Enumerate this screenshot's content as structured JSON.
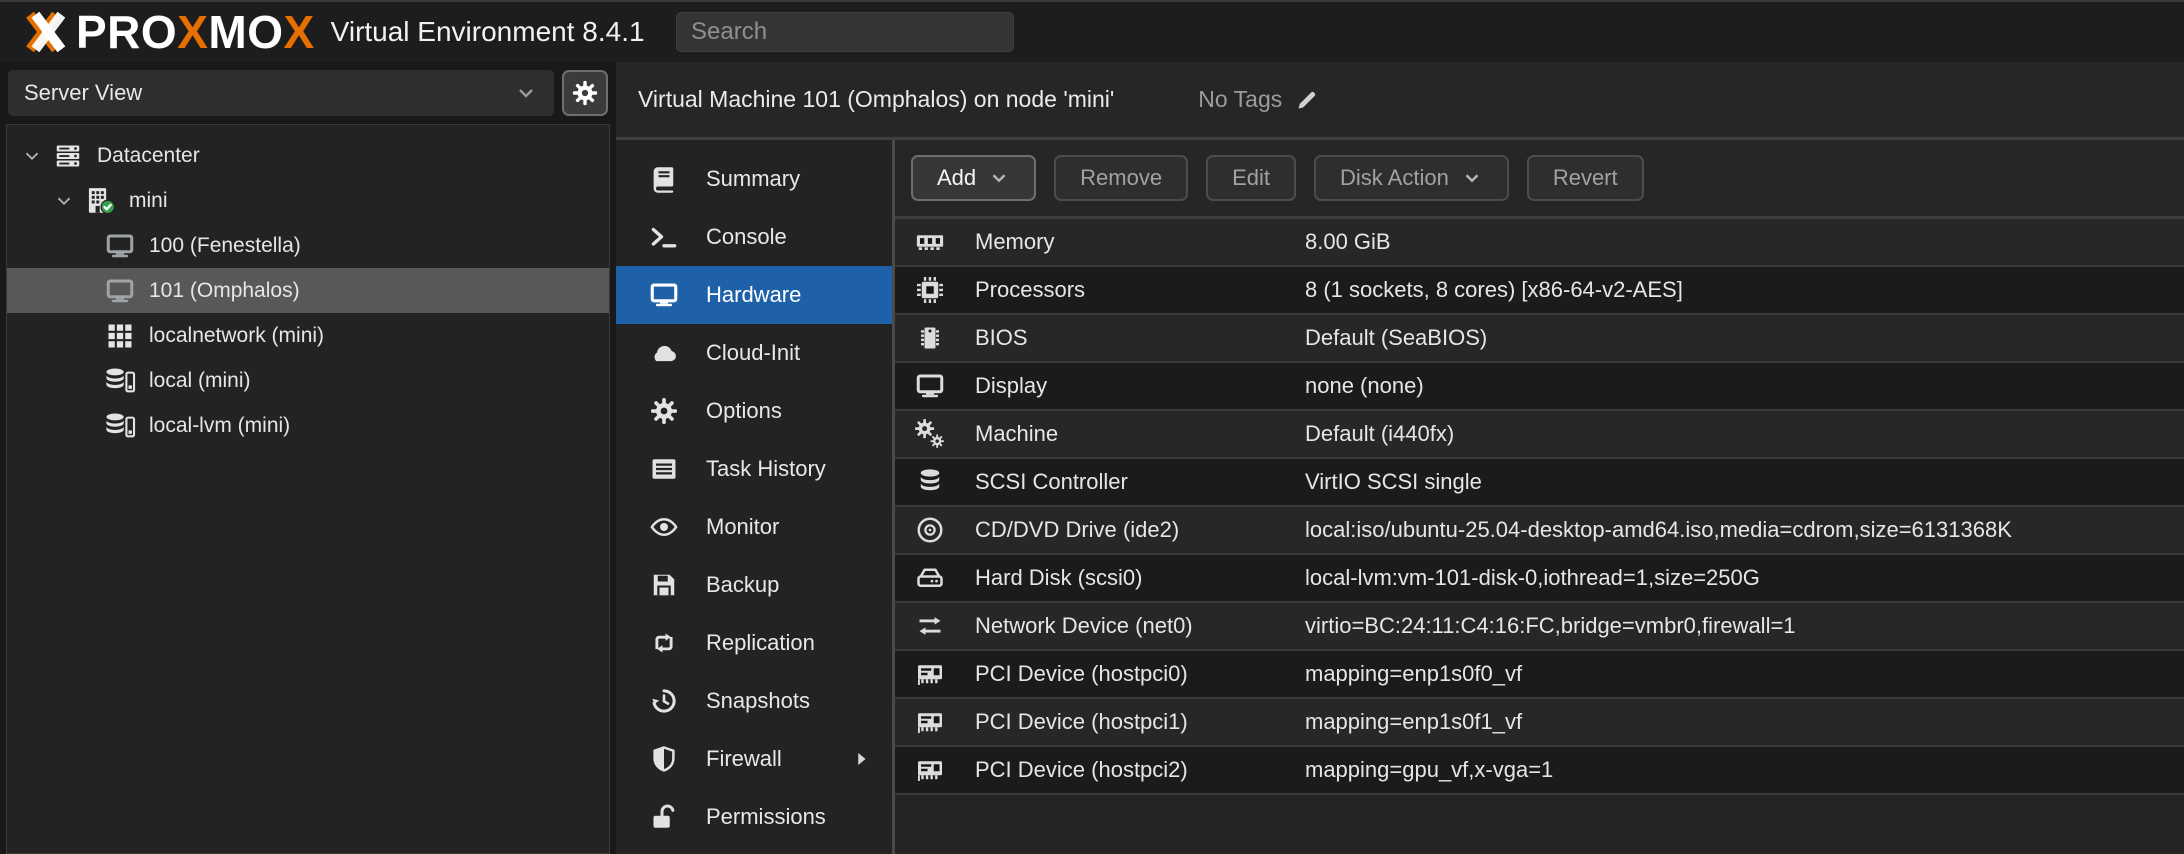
{
  "topbar": {
    "brand": {
      "part1": "PRO",
      "part2": "X",
      "part3": "MO",
      "part4": "X"
    },
    "version": "Virtual Environment 8.4.1",
    "search_placeholder": "Search"
  },
  "sidebar": {
    "view_selector_label": "Server View",
    "tree": [
      {
        "label": "Datacenter",
        "icon": "datacenter-server-icon",
        "level": 0,
        "expanded": true
      },
      {
        "label": "mini",
        "icon": "node-building-icon",
        "level": 1,
        "expanded": true,
        "status": "online"
      },
      {
        "label": "100 (Fenestella)",
        "icon": "vm-monitor-icon",
        "level": 2
      },
      {
        "label": "101 (Omphalos)",
        "icon": "vm-monitor-icon",
        "level": 2,
        "selected": true
      },
      {
        "label": "localnetwork (mini)",
        "icon": "network-grid-icon",
        "level": 2
      },
      {
        "label": "local (mini)",
        "icon": "storage-icon",
        "level": 2
      },
      {
        "label": "local-lvm (mini)",
        "icon": "storage-icon",
        "level": 2
      }
    ]
  },
  "header": {
    "title": "Virtual Machine 101 (Omphalos) on node 'mini'",
    "tags_label": "No Tags"
  },
  "tabs": [
    {
      "label": "Summary",
      "icon": "book-icon"
    },
    {
      "label": "Console",
      "icon": "terminal-icon"
    },
    {
      "label": "Hardware",
      "icon": "monitor-icon",
      "selected": true
    },
    {
      "label": "Cloud-Init",
      "icon": "cloud-icon"
    },
    {
      "label": "Options",
      "icon": "gear-icon"
    },
    {
      "label": "Task History",
      "icon": "list-icon"
    },
    {
      "label": "Monitor",
      "icon": "eye-icon"
    },
    {
      "label": "Backup",
      "icon": "floppy-icon"
    },
    {
      "label": "Replication",
      "icon": "replication-arrows-icon"
    },
    {
      "label": "Snapshots",
      "icon": "history-icon"
    },
    {
      "label": "Firewall",
      "icon": "shield-icon",
      "has_submenu": true
    },
    {
      "label": "Permissions",
      "icon": "unlock-icon"
    }
  ],
  "toolbar": {
    "add_label": "Add",
    "remove_label": "Remove",
    "edit_label": "Edit",
    "disk_action_label": "Disk Action",
    "revert_label": "Revert"
  },
  "hardware": {
    "rows": [
      {
        "icon": "memory-icon",
        "label": "Memory",
        "value": "8.00 GiB"
      },
      {
        "icon": "cpu-icon",
        "label": "Processors",
        "value": "8 (1 sockets, 8 cores) [x86-64-v2-AES]"
      },
      {
        "icon": "bios-chip-icon",
        "label": "BIOS",
        "value": "Default (SeaBIOS)"
      },
      {
        "icon": "display-icon",
        "label": "Display",
        "value": "none (none)"
      },
      {
        "icon": "machine-cogs-icon",
        "label": "Machine",
        "value": "Default (i440fx)"
      },
      {
        "icon": "scsi-database-icon",
        "label": "SCSI Controller",
        "value": "VirtIO SCSI single"
      },
      {
        "icon": "cdrom-disc-icon",
        "label": "CD/DVD Drive (ide2)",
        "value": "local:iso/ubuntu-25.04-desktop-amd64.iso,media=cdrom,size=6131368K"
      },
      {
        "icon": "hard-disk-icon",
        "label": "Hard Disk (scsi0)",
        "value": "local-lvm:vm-101-disk-0,iothread=1,size=250G"
      },
      {
        "icon": "network-arrows-icon",
        "label": "Network Device (net0)",
        "value": "virtio=BC:24:11:C4:16:FC,bridge=vmbr0,firewall=1"
      },
      {
        "icon": "pci-card-icon",
        "label": "PCI Device (hostpci0)",
        "value": "mapping=enp1s0f0_vf"
      },
      {
        "icon": "pci-card-icon",
        "label": "PCI Device (hostpci1)",
        "value": "mapping=enp1s0f1_vf"
      },
      {
        "icon": "pci-card-icon",
        "label": "PCI Device (hostpci2)",
        "value": "mapping=gpu_vf,x-vga=1"
      }
    ]
  },
  "colors": {
    "brand_orange": "#e57000",
    "tab_selected_blue": "#1f61a8",
    "tree_selected_gray": "#585858",
    "node_online_green": "#3aa14b"
  }
}
